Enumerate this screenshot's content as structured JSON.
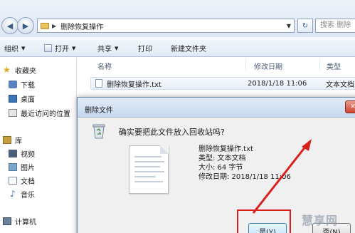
{
  "address_bar": {
    "path": "删除恢复操作",
    "search_placeholder": "搜索 删除"
  },
  "toolbar": {
    "organize": "组织",
    "open": "打开",
    "share": "共享",
    "print": "打印",
    "new_folder": "新建文件夹"
  },
  "sidebar": {
    "favorites": "收藏夹",
    "downloads": "下载",
    "desktop": "桌面",
    "recent": "最近访问的位置",
    "libraries": "库",
    "videos": "视频",
    "pictures": "图片",
    "documents": "文档",
    "music": "音乐",
    "computer": "计算机"
  },
  "content": {
    "columns": {
      "name": "名称",
      "date": "修改日期",
      "type": "类型"
    },
    "file": {
      "name": "删除恢复操作.txt",
      "date": "2018/1/18 11:06",
      "type": "文本文档"
    }
  },
  "dialog": {
    "title": "删除文件",
    "question": "确实要把此文件放入回收站吗?",
    "info": {
      "name": "删除恢复操作.txt",
      "type": "类型: 文本文档",
      "size": "大小: 64 字节",
      "date": "修改日期: 2018/1/18 11:06"
    },
    "yes": "是(Y)",
    "no": "否(N)"
  },
  "watermark": "慧享网",
  "colors": {
    "annotation": "#d9201d"
  }
}
